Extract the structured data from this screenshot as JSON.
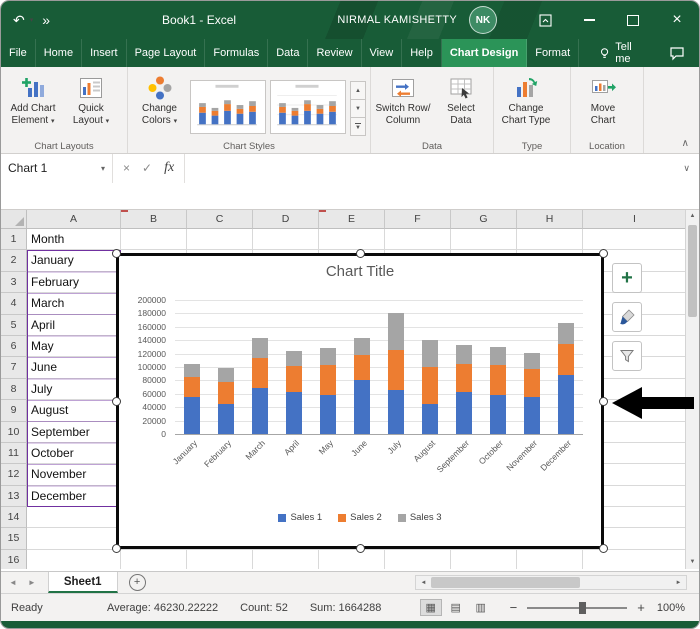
{
  "titlebar": {
    "title": "Book1 - Excel",
    "user_name": "NIRMAL KAMISHETTY",
    "user_initials": "NK"
  },
  "icons": {
    "undo": "↶",
    "qat_more": "»",
    "dropdown": "▾",
    "close": "×",
    "check": "✓",
    "cancel": "×",
    "collapse_ribbon": "∧",
    "expand_formula_bar": "∨",
    "scroll_up": "▲",
    "scroll_down": "▼",
    "scroll_left": "◄",
    "scroll_right": "►",
    "sheet_prev": "◄",
    "sheet_next": "►",
    "add": "+",
    "zoom_out": "−",
    "zoom_in": "+",
    "view_normal": "▦",
    "view_page_layout": "▤",
    "view_page_break": "▥",
    "gallery_up": "▲",
    "gallery_down": "▼",
    "gallery_more": "▼"
  },
  "tabs": [
    "File",
    "Home",
    "Insert",
    "Page Layout",
    "Formulas",
    "Data",
    "Review",
    "View",
    "Help",
    "Chart Design",
    "Format"
  ],
  "active_tab": "Chart Design",
  "tell_me": "Tell me",
  "ribbon": {
    "group_labels": [
      "Chart Layouts",
      "Chart Styles",
      "Data",
      "Type",
      "Location"
    ],
    "buttons": {
      "add_chart_element": [
        "Add Chart",
        "Element"
      ],
      "quick_layout": [
        "Quick",
        "Layout"
      ],
      "change_colors": [
        "Change",
        "Colors"
      ],
      "switch_row_column": [
        "Switch Row/",
        "Column"
      ],
      "select_data": [
        "Select",
        "Data"
      ],
      "change_chart_type": [
        "Change",
        "Chart Type"
      ],
      "move_chart": [
        "Move",
        "Chart"
      ]
    }
  },
  "formula_bar": {
    "name_box": "Chart 1",
    "fx": "fx",
    "value": ""
  },
  "grid": {
    "columns": [
      "A",
      "B",
      "C",
      "D",
      "E",
      "F",
      "G",
      "H",
      "I"
    ],
    "row_count": 16,
    "a_values": [
      "Month",
      "January",
      "February",
      "March",
      "April",
      "May",
      "June",
      "July",
      "August",
      "September",
      "October",
      "November",
      "December"
    ]
  },
  "chart_data": {
    "type": "bar",
    "stacked": true,
    "title": "Chart Title",
    "categories": [
      "January",
      "February",
      "March",
      "April",
      "May",
      "June",
      "July",
      "August",
      "September",
      "October",
      "November",
      "December"
    ],
    "series": [
      {
        "name": "Sales 1",
        "color": "#4472c4",
        "values": [
          55000,
          45000,
          68000,
          62000,
          58000,
          80000,
          65000,
          45000,
          63000,
          58000,
          55000,
          88000
        ]
      },
      {
        "name": "Sales 2",
        "color": "#ed7d31",
        "values": [
          30000,
          32000,
          45000,
          40000,
          45000,
          38000,
          60000,
          55000,
          42000,
          45000,
          42000,
          47000
        ]
      },
      {
        "name": "Sales 3",
        "color": "#a5a5a5",
        "values": [
          20000,
          21000,
          30000,
          22000,
          25000,
          25000,
          55000,
          40000,
          28000,
          27000,
          24000,
          30000
        ]
      }
    ],
    "ylim": [
      0,
      200000
    ],
    "ytick_step": 20000,
    "grid": true,
    "legend_position": "bottom"
  },
  "sheet": {
    "tabs": [
      "Sheet1"
    ],
    "active": "Sheet1"
  },
  "status_bar": {
    "ready": "Ready",
    "average": "Average: 46230.22222",
    "count": "Count: 52",
    "sum": "Sum: 1664288",
    "zoom": "100%"
  }
}
